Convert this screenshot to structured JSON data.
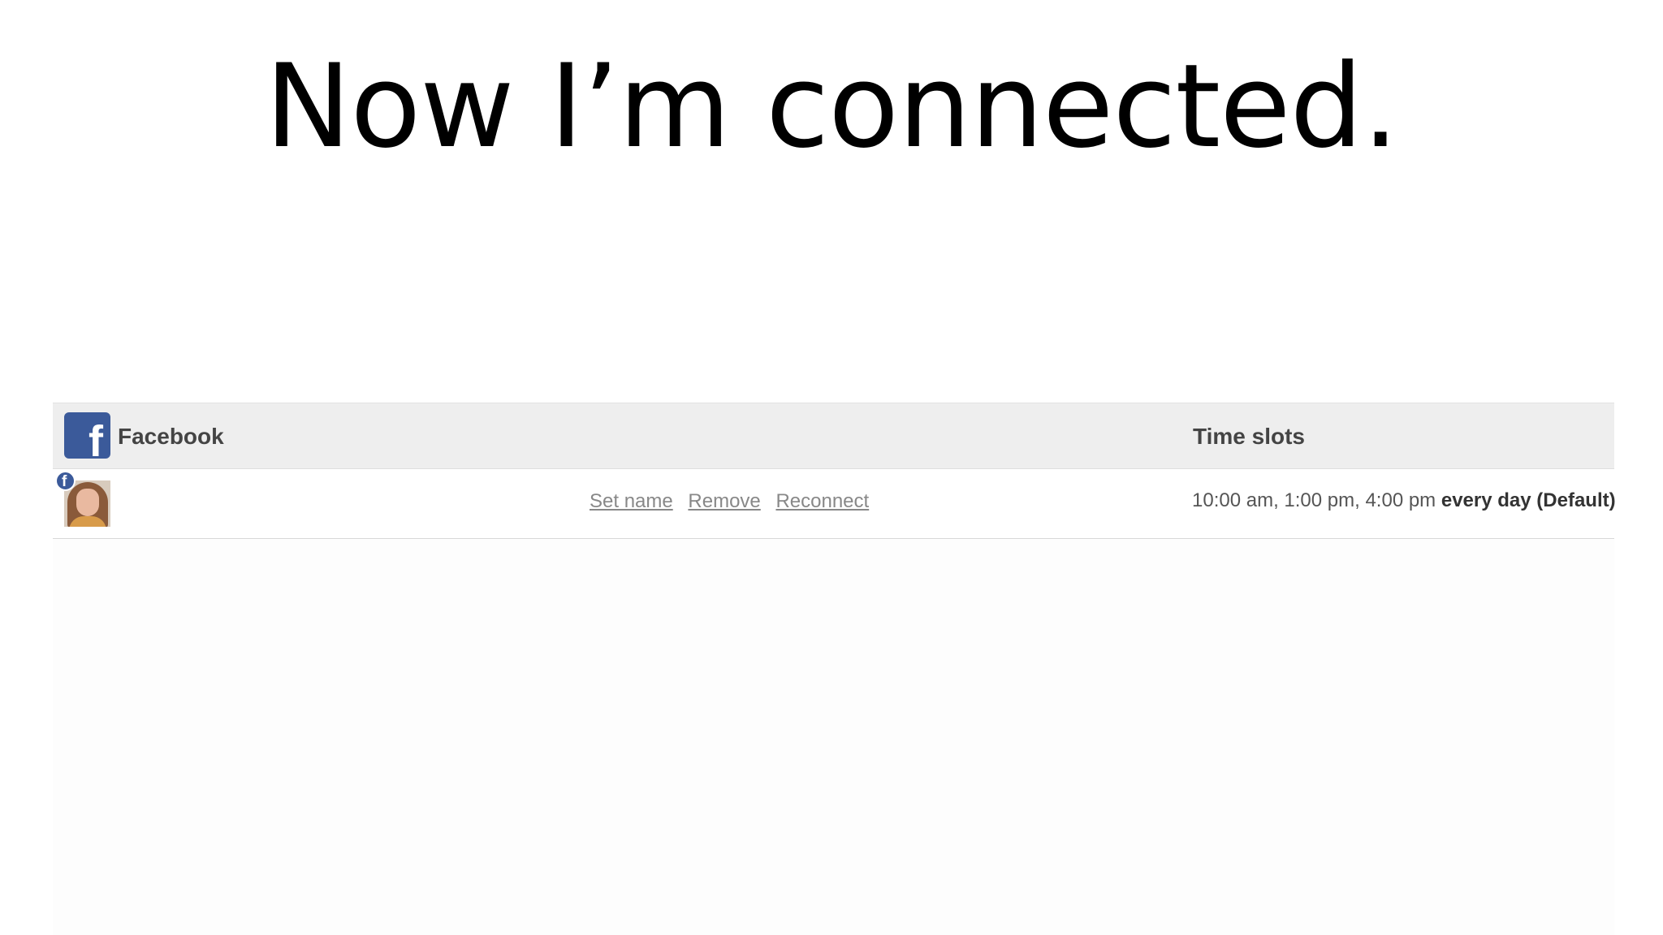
{
  "slide": {
    "title": "Now I’m connected."
  },
  "service": {
    "logo_icon": "facebook-icon",
    "logo_color": "#3b5a9a",
    "logo_glyph": "f",
    "name": "Facebook",
    "timeslots_header": "Time slots"
  },
  "account": {
    "avatar": "profile-photo",
    "badge_icon": "facebook-badge-icon",
    "badge_glyph": "f",
    "actions": {
      "set_name": "Set name",
      "remove": "Remove",
      "reconnect": "Reconnect"
    },
    "time_slots": "10:00 am, 1:00 pm, 4:00 pm",
    "frequency": "every day (Default)"
  }
}
